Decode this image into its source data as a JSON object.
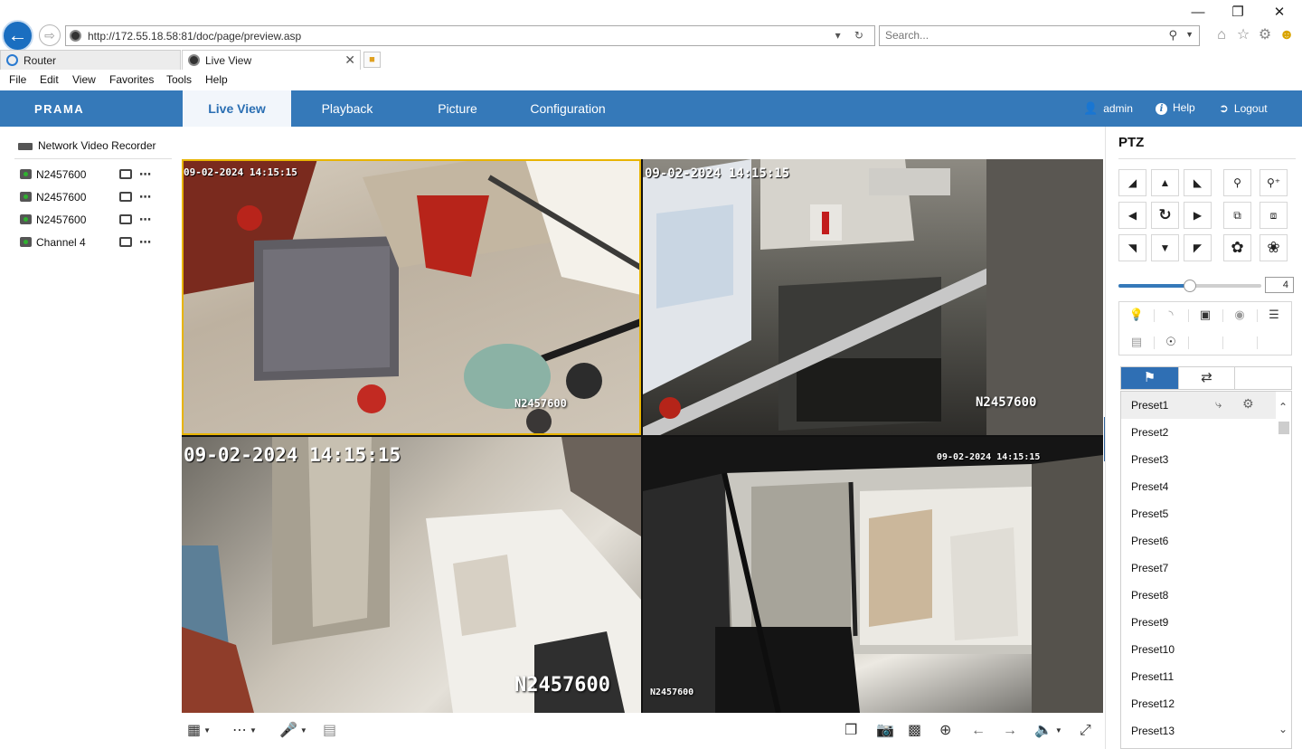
{
  "browser": {
    "address": "http://172.55.18.58:81/doc/page/preview.asp",
    "search_placeholder": "Search...",
    "tabs": [
      {
        "label": "Router",
        "icon": "ie-icon"
      },
      {
        "label": "Live View",
        "icon": "site-icon"
      }
    ],
    "menu": [
      "File",
      "Edit",
      "View",
      "Favorites",
      "Tools",
      "Help"
    ]
  },
  "app": {
    "brand": "PRAMA",
    "nav_tabs": [
      "Live View",
      "Playback",
      "Picture",
      "Configuration"
    ],
    "active_nav": "Live View",
    "user": "admin",
    "help": "Help",
    "logout": "Logout",
    "accent_color": "#3579b9"
  },
  "devices": {
    "recorder": "Network Video Recorder",
    "channels": [
      "N2457600",
      "N2457600",
      "N2457600",
      "Channel 4"
    ]
  },
  "cameras": [
    {
      "timestamp": "09-02-2024 14:15:15",
      "name": "N2457600"
    },
    {
      "timestamp": "09-02-2024 14:15:15",
      "name": "N2457600"
    },
    {
      "timestamp": "09-02-2024 14:15:15",
      "name": "N2457600"
    },
    {
      "timestamp": "09-02-2024 14:15:15",
      "name": "N2457600"
    }
  ],
  "ptz": {
    "title": "PTZ",
    "speed": 4,
    "speed_max": 7,
    "presets": [
      "Preset1",
      "Preset2",
      "Preset3",
      "Preset4",
      "Preset5",
      "Preset6",
      "Preset7",
      "Preset8",
      "Preset9",
      "Preset10",
      "Preset11",
      "Preset12",
      "Preset13"
    ],
    "active_preset": "Preset1"
  }
}
